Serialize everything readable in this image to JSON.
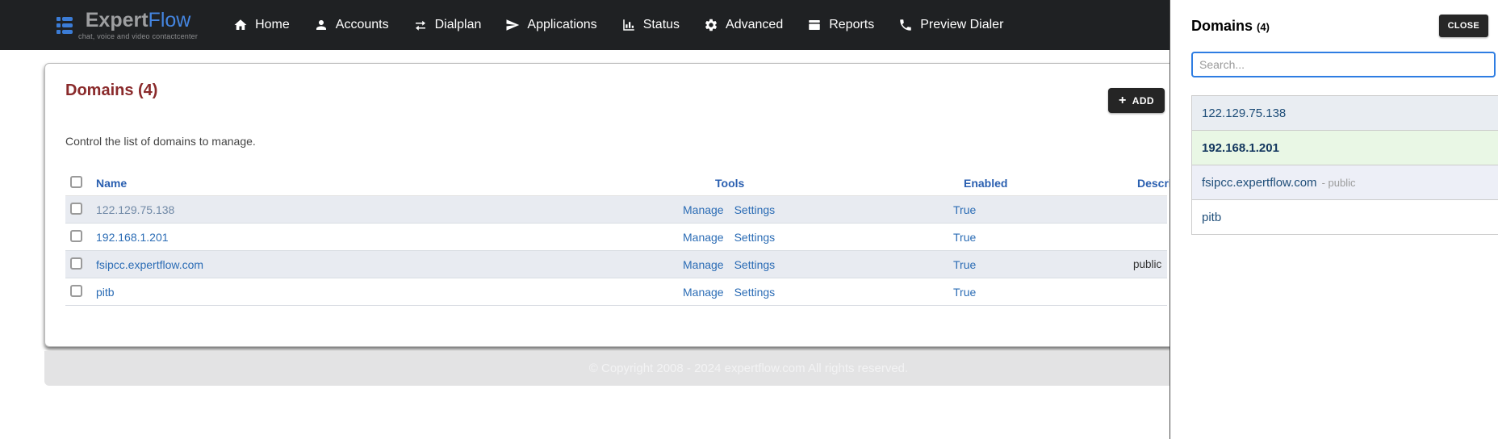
{
  "brand": {
    "name_primary": "Expert",
    "name_secondary": "Flow",
    "tagline": "chat, voice and video contactcenter"
  },
  "nav": {
    "items": [
      {
        "label": "Home",
        "icon": "home-icon"
      },
      {
        "label": "Accounts",
        "icon": "user-icon"
      },
      {
        "label": "Dialplan",
        "icon": "exchange-arrows-icon"
      },
      {
        "label": "Applications",
        "icon": "paper-plane-icon"
      },
      {
        "label": "Status",
        "icon": "bar-chart-icon"
      },
      {
        "label": "Advanced",
        "icon": "gear-icon"
      },
      {
        "label": "Reports",
        "icon": "window-icon"
      },
      {
        "label": "Preview Dialer",
        "icon": "phone-icon"
      }
    ]
  },
  "page": {
    "title": "Domains (4)",
    "subtitle": "Control the list of domains to manage.",
    "add_button": {
      "plus": "+",
      "label": "ADD"
    },
    "table": {
      "headers": {
        "name": "Name",
        "tools": "Tools",
        "enabled": "Enabled",
        "description": "Description"
      },
      "rows": [
        {
          "name": "122.129.75.138",
          "tools": [
            "Manage",
            "Settings"
          ],
          "enabled": "True",
          "description": ""
        },
        {
          "name": "192.168.1.201",
          "tools": [
            "Manage",
            "Settings"
          ],
          "enabled": "True",
          "description": ""
        },
        {
          "name": "fsipcc.expertflow.com",
          "tools": [
            "Manage",
            "Settings"
          ],
          "enabled": "True",
          "description": "public"
        },
        {
          "name": "pitb",
          "tools": [
            "Manage",
            "Settings"
          ],
          "enabled": "True",
          "description": ""
        }
      ]
    }
  },
  "footer": {
    "copyright": "© Copyright 2008 - 2024 expertflow.com All rights reserved."
  },
  "panel": {
    "title": "Domains",
    "count": "(4)",
    "close_label": "CLOSE",
    "search": {
      "placeholder": "Search...",
      "value": ""
    },
    "items": [
      {
        "label": "122.129.75.138",
        "suffix": "",
        "selected": false
      },
      {
        "label": "192.168.1.201",
        "suffix": "",
        "selected": true
      },
      {
        "label": "fsipcc.expertflow.com",
        "suffix": "- public",
        "selected": false
      },
      {
        "label": "pitb",
        "suffix": "",
        "selected": false
      }
    ]
  },
  "colors": {
    "navbar_bg": "#1f2123",
    "brand_blue": "#4485e0",
    "heading_red": "#8a2a2b",
    "header_blue": "#2a5fb0",
    "link_blue": "#2b6cb5",
    "stripe_bg": "#e8ebf1",
    "selected_green_bg": "#e9f7e5",
    "button_dark": "#262626",
    "search_focus_blue": "#2e7de2"
  }
}
